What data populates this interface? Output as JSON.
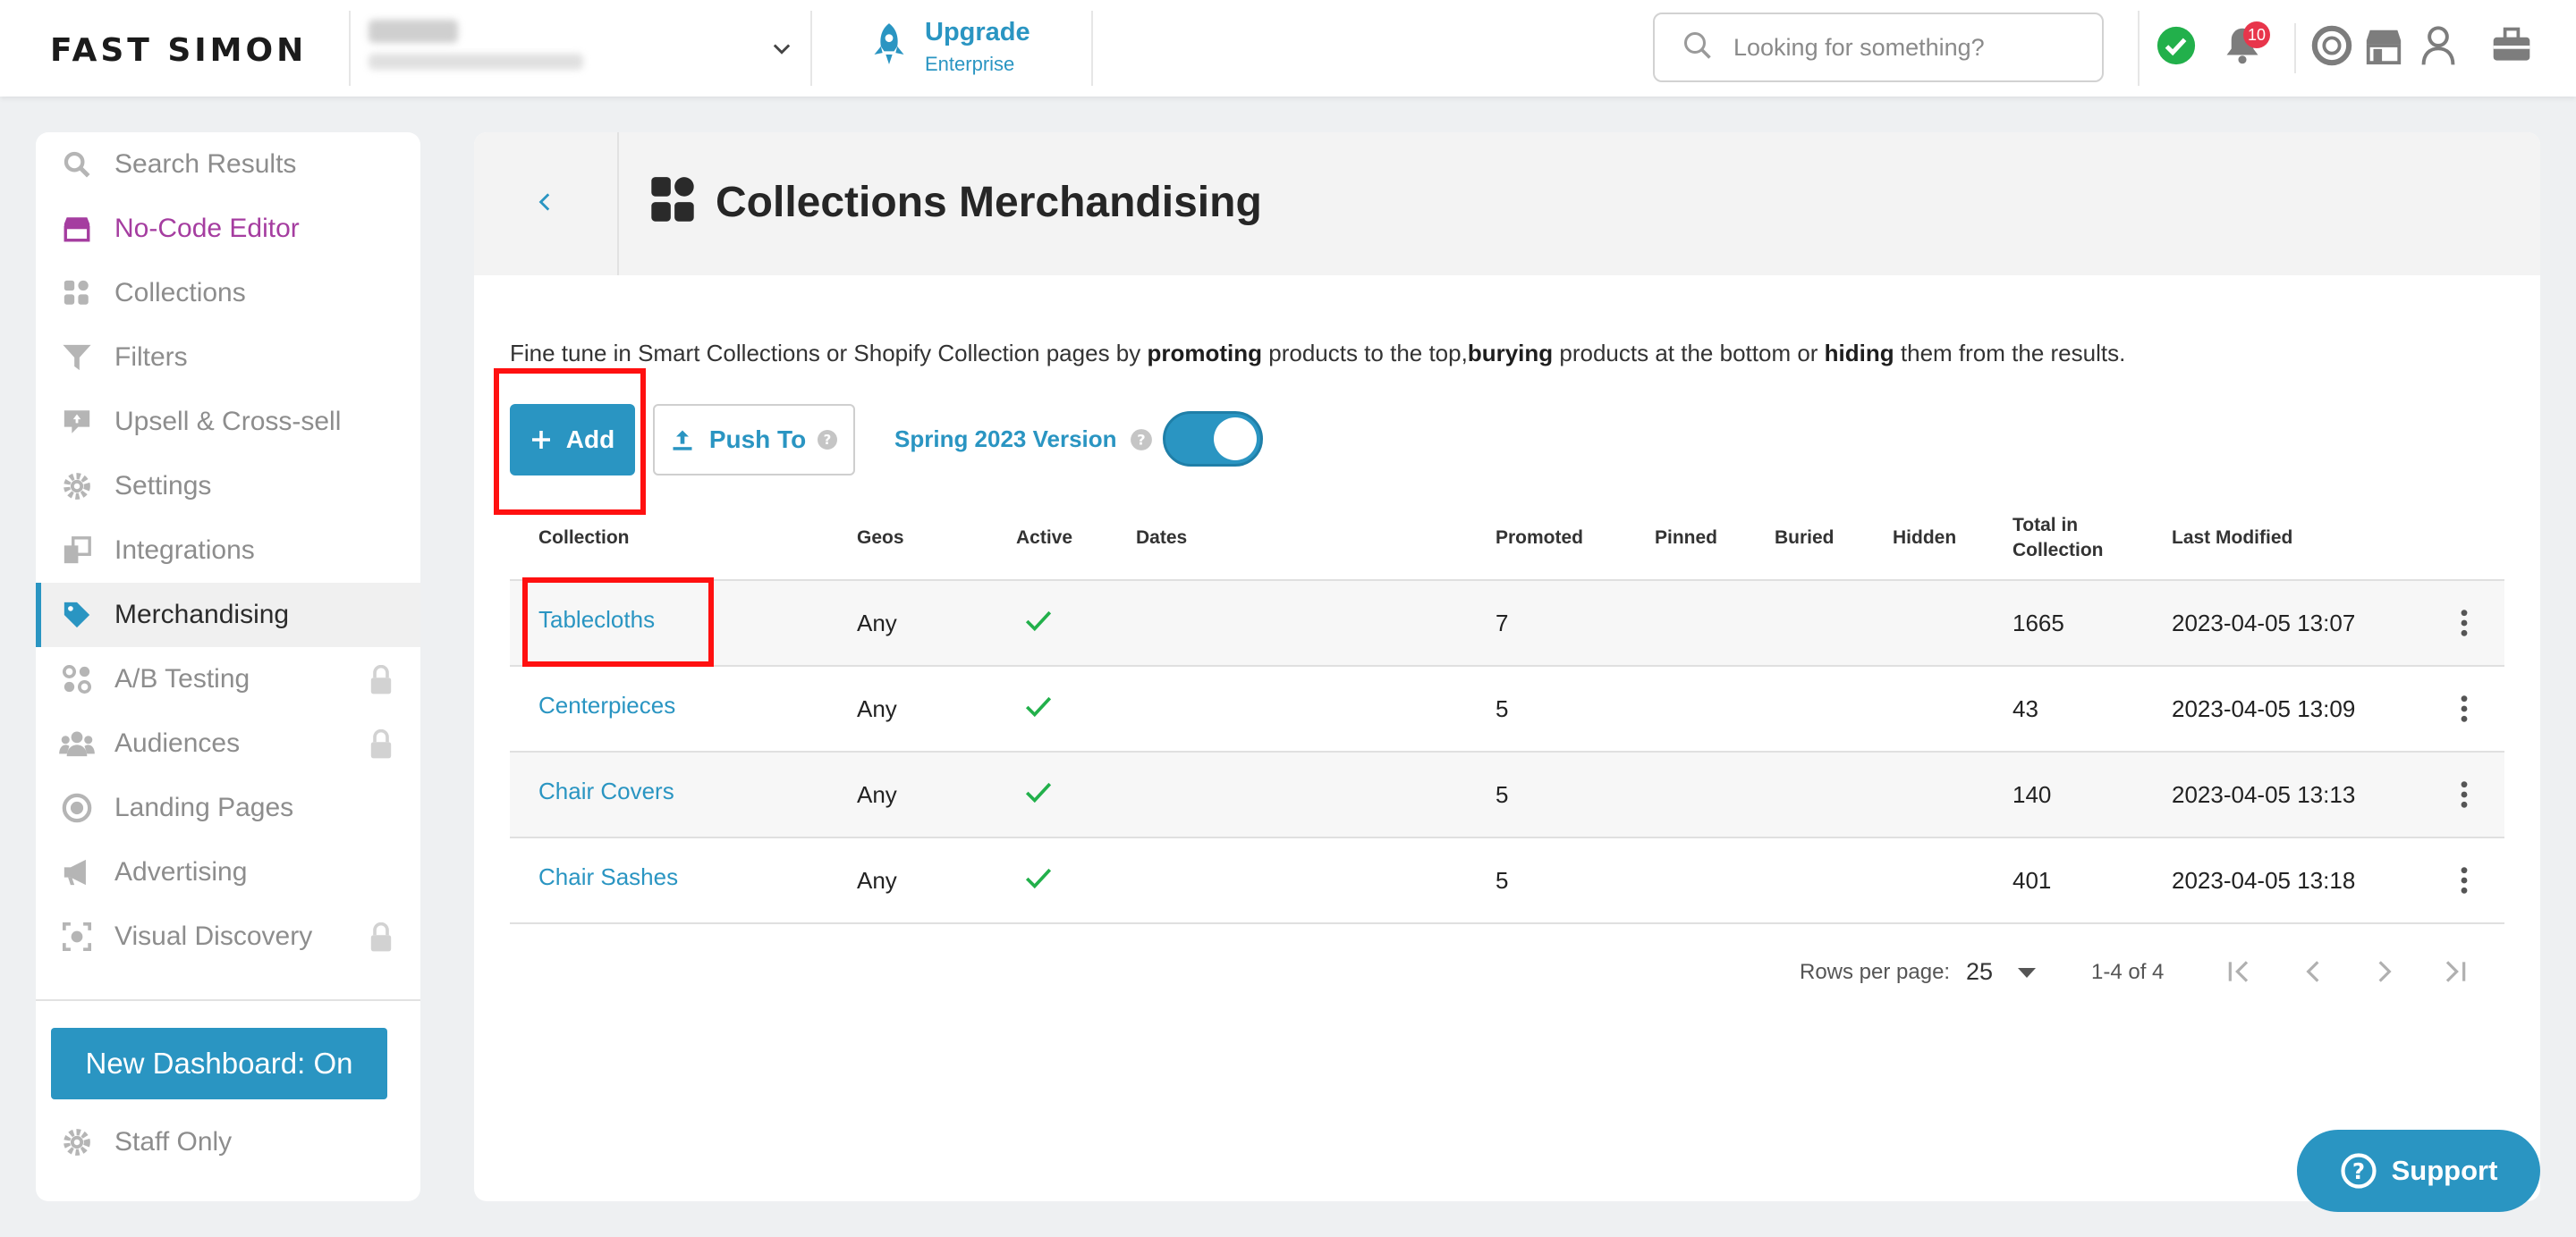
{
  "brand": {
    "logo_text": "FAST SIMON",
    "accent": "#2a95c2",
    "purple": "#a53da0"
  },
  "header": {
    "upgrade_title": "Upgrade",
    "upgrade_subtitle": "Enterprise",
    "search_placeholder": "Looking for something?",
    "notification_count": "10",
    "icons": [
      "status-check-icon",
      "bell-icon",
      "lifebuoy-icon",
      "store-icon",
      "user-icon",
      "toolbox-icon"
    ]
  },
  "sidebar": {
    "items": [
      {
        "label": "Search Results",
        "icon": "search-icon",
        "locked": false
      },
      {
        "label": "No-Code Editor",
        "icon": "store-icon",
        "locked": false
      },
      {
        "label": "Collections",
        "icon": "collections-icon",
        "locked": false
      },
      {
        "label": "Filters",
        "icon": "filter-icon",
        "locked": false
      },
      {
        "label": "Upsell & Cross-sell",
        "icon": "upsell-icon",
        "locked": false
      },
      {
        "label": "Settings",
        "icon": "gear-icon",
        "locked": false
      },
      {
        "label": "Integrations",
        "icon": "integrations-icon",
        "locked": false
      },
      {
        "label": "Merchandising",
        "icon": "tag-icon",
        "locked": false
      },
      {
        "label": "A/B Testing",
        "icon": "ab-testing-icon",
        "locked": true
      },
      {
        "label": "Audiences",
        "icon": "audiences-icon",
        "locked": true
      },
      {
        "label": "Landing Pages",
        "icon": "target-icon",
        "locked": false
      },
      {
        "label": "Advertising",
        "icon": "megaphone-icon",
        "locked": false
      },
      {
        "label": "Visual Discovery",
        "icon": "camera-scan-icon",
        "locked": true
      }
    ],
    "active_label": "Merchandising",
    "new_dashboard_button": "New Dashboard: On",
    "staff_only": "Staff Only"
  },
  "page": {
    "title": "Collections Merchandising",
    "description_parts": [
      "Fine tune in Smart Collections or Shopify Collection pages by ",
      "promoting",
      " products to the top,",
      "burying",
      " products at the bottom or ",
      "hiding",
      " them from the results."
    ],
    "add_button": "Add",
    "push_button": "Push To",
    "version_label": "Spring 2023 Version",
    "version_toggle_on": true
  },
  "table": {
    "columns": [
      "Collection",
      "Geos",
      "Active",
      "Dates",
      "Promoted",
      "Pinned",
      "Buried",
      "Hidden",
      "Total in Collection",
      "Last Modified"
    ],
    "rows": [
      {
        "collection": "Tablecloths",
        "geos": "Any",
        "active": true,
        "dates": "",
        "promoted": "7",
        "pinned": "",
        "buried": "",
        "hidden": "",
        "total": "1665",
        "modified": "2023-04-05 13:07"
      },
      {
        "collection": "Centerpieces",
        "geos": "Any",
        "active": true,
        "dates": "",
        "promoted": "5",
        "pinned": "",
        "buried": "",
        "hidden": "",
        "total": "43",
        "modified": "2023-04-05 13:09"
      },
      {
        "collection": "Chair Covers",
        "geos": "Any",
        "active": true,
        "dates": "",
        "promoted": "5",
        "pinned": "",
        "buried": "",
        "hidden": "",
        "total": "140",
        "modified": "2023-04-05 13:13"
      },
      {
        "collection": "Chair Sashes",
        "geos": "Any",
        "active": true,
        "dates": "",
        "promoted": "5",
        "pinned": "",
        "buried": "",
        "hidden": "",
        "total": "401",
        "modified": "2023-04-05 13:18"
      }
    ]
  },
  "pagination": {
    "rows_per_page_label": "Rows per page:",
    "rows_per_page_value": "25",
    "range_text": "1-4 of 4"
  },
  "support_button": "Support"
}
